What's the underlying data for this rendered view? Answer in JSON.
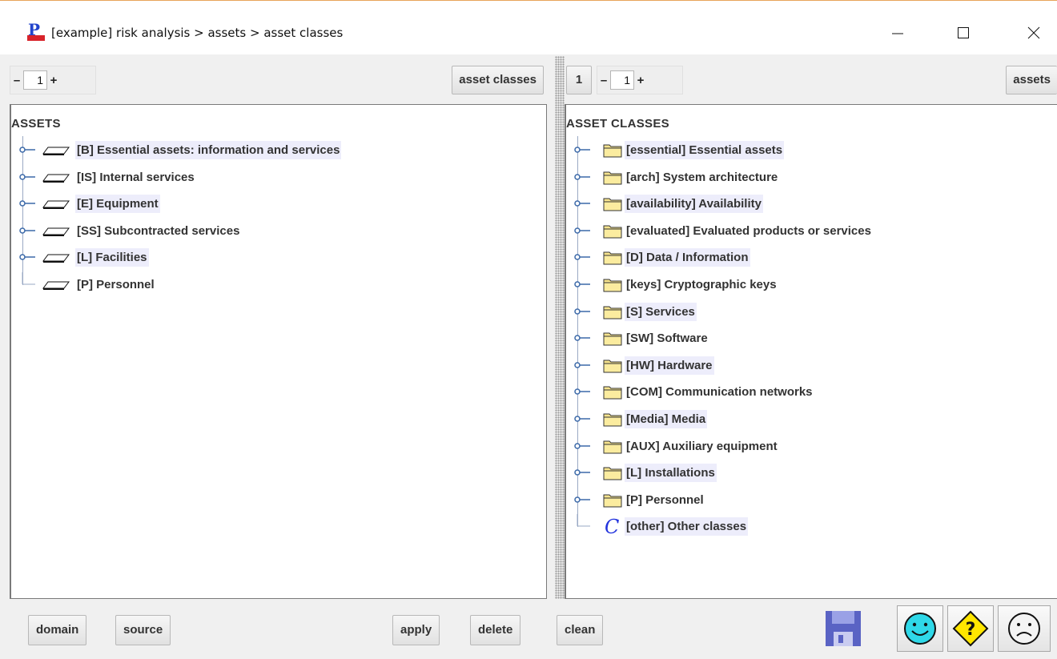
{
  "window": {
    "title": "[example] risk analysis > assets > asset classes",
    "app_icon": "pilar-ccn-logo",
    "controls": [
      "minimize-icon",
      "maximize-icon",
      "close-icon"
    ]
  },
  "left_pane": {
    "spinner": {
      "minus": "–",
      "value": "1",
      "plus": "+"
    },
    "nav_button": "asset classes",
    "root_label": "ASSETS",
    "items": [
      {
        "label": "[B] Essential assets: information and services",
        "expandable": true,
        "highlighted": true,
        "icon": "layer-icon"
      },
      {
        "label": "[IS] Internal services",
        "expandable": true,
        "highlighted": false,
        "icon": "layer-icon"
      },
      {
        "label": "[E] Equipment",
        "expandable": true,
        "highlighted": true,
        "icon": "layer-icon"
      },
      {
        "label": "[SS] Subcontracted services",
        "expandable": true,
        "highlighted": false,
        "icon": "layer-icon"
      },
      {
        "label": "[L] Facilities",
        "expandable": true,
        "highlighted": true,
        "icon": "layer-icon"
      },
      {
        "label": "[P] Personnel",
        "expandable": false,
        "highlighted": false,
        "icon": "layer-icon"
      }
    ]
  },
  "right_pane": {
    "level": "1",
    "spinner": {
      "minus": "–",
      "value": "1",
      "plus": "+"
    },
    "nav_button": "assets",
    "root_label": "ASSET CLASSES",
    "items": [
      {
        "label": "[essential] Essential assets",
        "expandable": true,
        "highlighted": true,
        "icon": "folder-icon"
      },
      {
        "label": "[arch] System architecture",
        "expandable": true,
        "highlighted": false,
        "icon": "folder-icon"
      },
      {
        "label": "[availability] Availability",
        "expandable": true,
        "highlighted": true,
        "icon": "folder-icon"
      },
      {
        "label": "[evaluated] Evaluated products or services",
        "expandable": true,
        "highlighted": false,
        "icon": "folder-icon"
      },
      {
        "label": "[D] Data / Information",
        "expandable": true,
        "highlighted": true,
        "icon": "folder-icon"
      },
      {
        "label": "[keys] Cryptographic keys",
        "expandable": true,
        "highlighted": false,
        "icon": "folder-icon"
      },
      {
        "label": "[S] Services",
        "expandable": true,
        "highlighted": true,
        "icon": "folder-icon"
      },
      {
        "label": "[SW] Software",
        "expandable": true,
        "highlighted": false,
        "icon": "folder-icon"
      },
      {
        "label": "[HW] Hardware",
        "expandable": true,
        "highlighted": true,
        "icon": "folder-icon"
      },
      {
        "label": "[COM] Communication networks",
        "expandable": true,
        "highlighted": false,
        "icon": "folder-icon"
      },
      {
        "label": "[Media] Media",
        "expandable": true,
        "highlighted": true,
        "icon": "folder-icon"
      },
      {
        "label": "[AUX] Auxiliary equipment",
        "expandable": true,
        "highlighted": false,
        "icon": "folder-icon"
      },
      {
        "label": "[L] Installations",
        "expandable": true,
        "highlighted": true,
        "icon": "folder-icon"
      },
      {
        "label": "[P] Personnel",
        "expandable": true,
        "highlighted": false,
        "icon": "folder-icon"
      },
      {
        "label": "[other] Other classes",
        "expandable": false,
        "highlighted": true,
        "icon": "class-c-icon"
      }
    ]
  },
  "bottom_bar": {
    "buttons": [
      "domain",
      "source",
      "apply",
      "delete",
      "clean"
    ],
    "icon_buttons": [
      "save-disk-icon",
      "happy-face-icon",
      "help-diamond-icon",
      "sad-face-icon"
    ]
  },
  "colors": {
    "highlight": "#ededfb",
    "folder": "#f6e38d",
    "save_disk": "#5a63c4",
    "smiley": "#2fd8e8",
    "help": "#ffe600"
  }
}
